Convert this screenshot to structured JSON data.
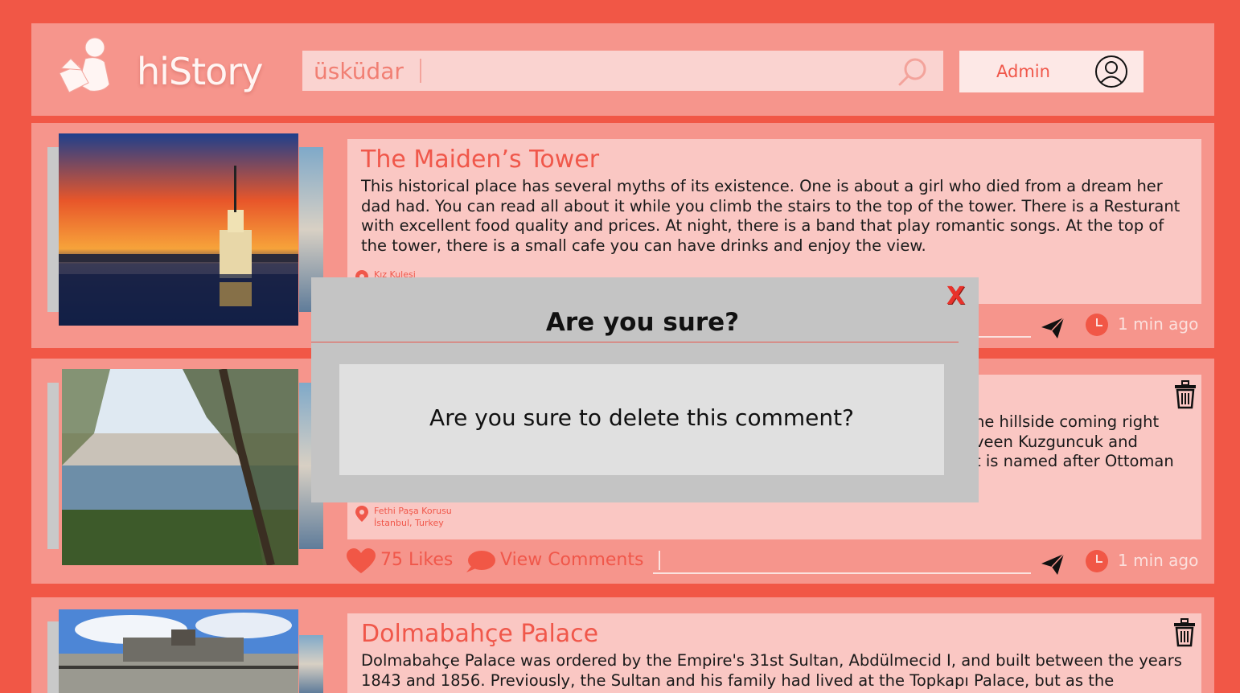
{
  "app": {
    "name": "hiStory",
    "search_value": "üsküdar",
    "user_label": "Admin"
  },
  "colors": {
    "background": "#f15746",
    "card": "#f6958c",
    "content": "#fac7c3",
    "accent": "#f0574a"
  },
  "icons": {
    "logo": "person-reading-icon",
    "search": "search-icon",
    "avatar": "user-circle-icon",
    "location": "location-pin-icon",
    "trash": "trash-icon",
    "like": "heart-icon",
    "comments": "speech-bubble-icon",
    "send": "paper-plane-icon",
    "time": "clock-icon",
    "close": "close-icon"
  },
  "posts": [
    {
      "title": "The Maiden’s Tower",
      "body": "This historical place has several myths of its existence. One is about a girl who died from a dream her dad had. You can read all about it while you climb the stairs to the top of the tower. There is a Resturant with excellent food quality and prices. At night, there is a band that play romantic songs. At the top of the tower, there is a small cafe you can have drinks and enjoy the view.",
      "location": "Kız Kulesi",
      "time": "1 min ago"
    },
    {
      "body_visible": "he hillside coming right\nveen Kuzguncuk and\nt is named after Ottoman",
      "location_line1": "Fethi Paşa Korusu",
      "location_line2": "İstanbul, Turkey",
      "likes": "75 Likes",
      "view_comments": "View Comments",
      "time": "1 min ago"
    },
    {
      "title": "Dolmabahçe Palace",
      "body": "Dolmabahçe Palace was ordered by the Empire's 31st Sultan, Abdülmecid I, and built between the years 1843 and 1856. Previously, the Sultan and his family had lived at the Topkapı Palace, but as the"
    }
  ],
  "modal": {
    "close_label": "X",
    "title": "Are you sure?",
    "message": "Are you sure to delete this comment?"
  }
}
